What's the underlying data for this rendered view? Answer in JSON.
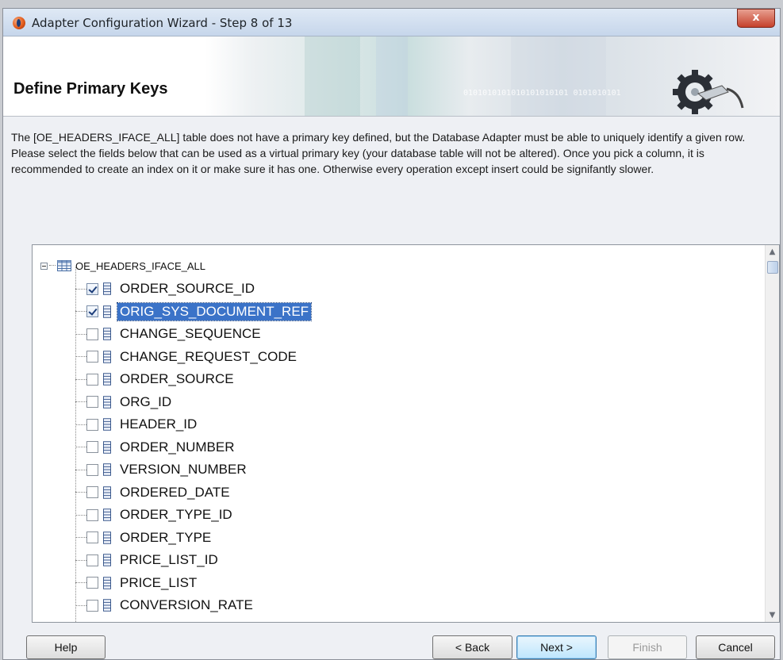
{
  "window": {
    "title": "Adapter Configuration Wizard - Step 8 of 13",
    "close_label": "x"
  },
  "banner": {
    "title": "Define Primary Keys",
    "binary_text": "0101010101010101010101 0101010101"
  },
  "instructions": "The [OE_HEADERS_IFACE_ALL] table does not have a primary key defined, but the Database Adapter must be able to uniquely identify a given row.  Please select the fields below that can be used as a virtual primary key (your database table will not be altered).  Once you pick a column, it is recommended to create an index on it or make sure it has one.  Otherwise every operation except insert could be signifantly slower.",
  "tree": {
    "root_label": "OE_HEADERS_IFACE_ALL",
    "columns": [
      {
        "label": "ORDER_SOURCE_ID",
        "checked": true,
        "selected": false
      },
      {
        "label": "ORIG_SYS_DOCUMENT_REF",
        "checked": true,
        "selected": true
      },
      {
        "label": "CHANGE_SEQUENCE",
        "checked": false,
        "selected": false
      },
      {
        "label": "CHANGE_REQUEST_CODE",
        "checked": false,
        "selected": false
      },
      {
        "label": "ORDER_SOURCE",
        "checked": false,
        "selected": false
      },
      {
        "label": "ORG_ID",
        "checked": false,
        "selected": false
      },
      {
        "label": "HEADER_ID",
        "checked": false,
        "selected": false
      },
      {
        "label": "ORDER_NUMBER",
        "checked": false,
        "selected": false
      },
      {
        "label": "VERSION_NUMBER",
        "checked": false,
        "selected": false
      },
      {
        "label": "ORDERED_DATE",
        "checked": false,
        "selected": false
      },
      {
        "label": "ORDER_TYPE_ID",
        "checked": false,
        "selected": false
      },
      {
        "label": "ORDER_TYPE",
        "checked": false,
        "selected": false
      },
      {
        "label": "PRICE_LIST_ID",
        "checked": false,
        "selected": false
      },
      {
        "label": "PRICE_LIST",
        "checked": false,
        "selected": false
      },
      {
        "label": "CONVERSION_RATE",
        "checked": false,
        "selected": false
      }
    ]
  },
  "buttons": {
    "help": "Help",
    "back": "< Back",
    "next": "Next >",
    "finish": "Finish",
    "cancel": "Cancel"
  },
  "colors": {
    "selection": "#3b73c8",
    "close": "#c5412c"
  }
}
